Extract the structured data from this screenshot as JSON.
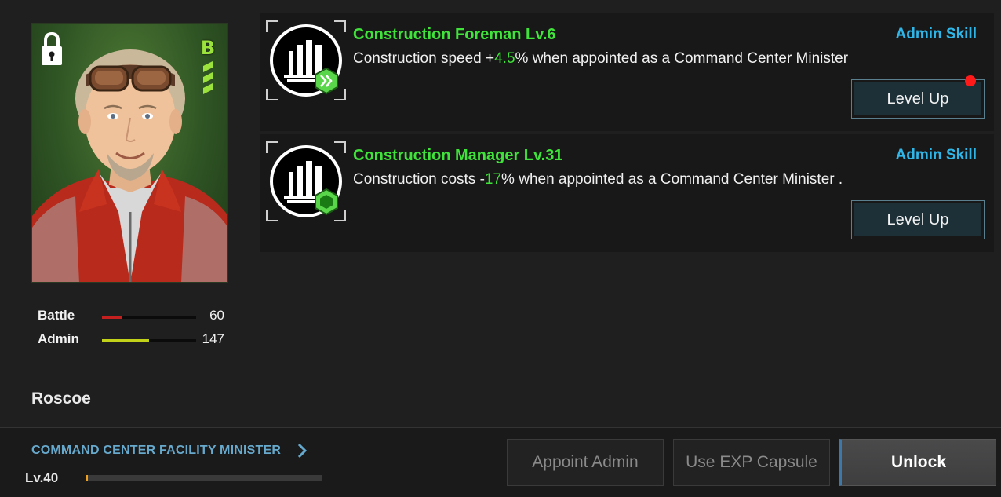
{
  "officer": {
    "name": "Roscoe",
    "rank": "B",
    "stats": [
      {
        "label": "Battle",
        "value": "60",
        "fill": 0.22,
        "color": "#c42020"
      },
      {
        "label": "Admin",
        "value": "147",
        "fill": 0.5,
        "color": "#c2d218"
      }
    ]
  },
  "skills": [
    {
      "title": "Construction Foreman Lv.6",
      "type": "Admin Skill",
      "desc_before": "Construction speed +",
      "desc_value": "4.5",
      "desc_after": "% when appointed as a Command Center Minister",
      "button": "Level Up",
      "notification": true
    },
    {
      "title": "Construction Manager Lv.31",
      "type": "Admin Skill",
      "desc_before": "Construction costs -",
      "desc_value": "17",
      "desc_after": "% when appointed as a Command Center Minister .",
      "button": "Level Up",
      "notification": false
    }
  ],
  "footer": {
    "facility": "COMMAND CENTER FACILITY MINISTER",
    "level": "Lv.40",
    "exp_fill": 0.005,
    "buttons": {
      "appoint": "Appoint Admin",
      "capsule": "Use EXP Capsule",
      "unlock": "Unlock"
    }
  }
}
